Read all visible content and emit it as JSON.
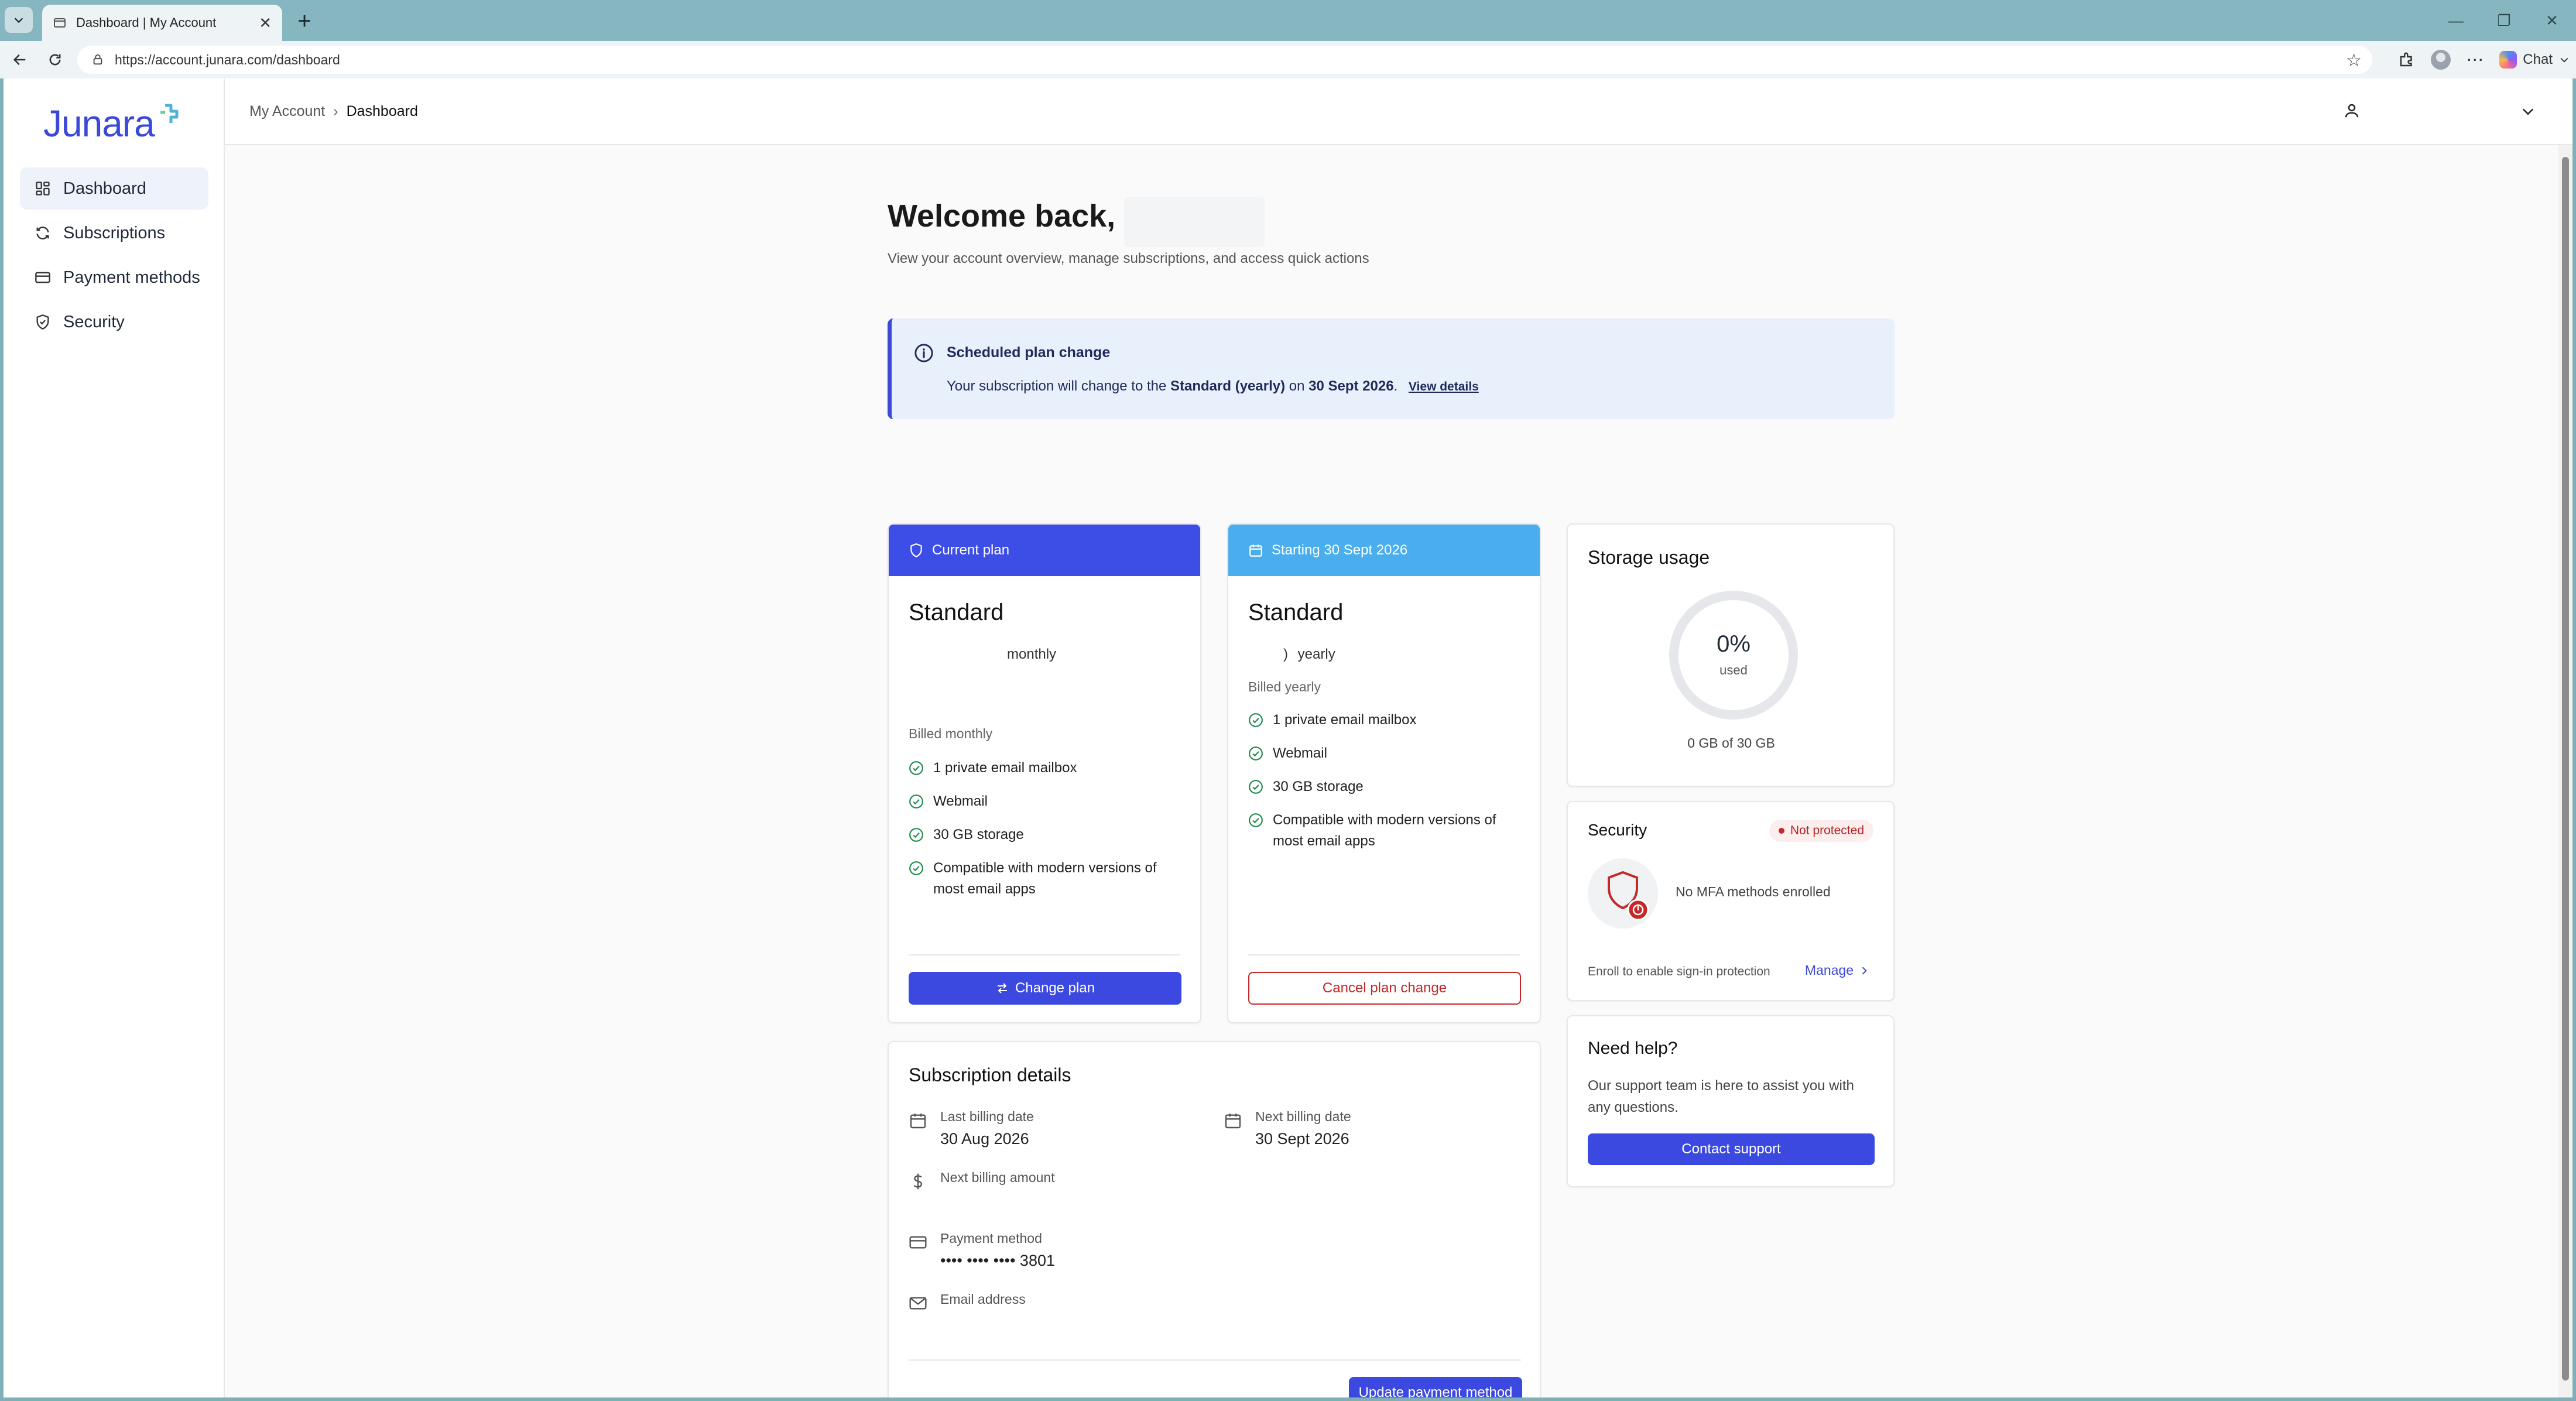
{
  "browser": {
    "tab_title": "Dashboard | My Account",
    "url": "https://account.junara.com/dashboard",
    "chat_label": "Chat"
  },
  "sidebar": {
    "logo_text": "Junara",
    "items": [
      {
        "label": "Dashboard",
        "icon": "dashboard-grid-icon"
      },
      {
        "label": "Subscriptions",
        "icon": "refresh-icon"
      },
      {
        "label": "Payment methods",
        "icon": "credit-card-icon"
      },
      {
        "label": "Security",
        "icon": "shield-check-icon"
      }
    ]
  },
  "header": {
    "breadcrumb": {
      "parent": "My Account",
      "current": "Dashboard"
    }
  },
  "main": {
    "welcome": "Welcome back,",
    "subtitle": "View your account overview, manage subscriptions, and access quick actions"
  },
  "alert": {
    "title": "Scheduled plan change",
    "body_prefix": "Your subscription will change to the",
    "plan": "Standard (yearly)",
    "on": "on",
    "date": "30 Sept 2026",
    "period": ".",
    "link": "View details"
  },
  "current_plan": {
    "header": "Current plan",
    "name": "Standard",
    "cycle": "monthly",
    "billed": "Billed monthly",
    "features": [
      "1 private email mailbox",
      "Webmail",
      "30 GB storage",
      "Compatible with modern versions of most email apps"
    ],
    "button": "Change plan"
  },
  "next_plan": {
    "header": "Starting 30 Sept 2026",
    "name": "Standard",
    "cycle_prefix": ")",
    "cycle": "yearly",
    "billed": "Billed yearly",
    "features": [
      "1 private email mailbox",
      "Webmail",
      "30 GB storage",
      "Compatible with modern versions of most email apps"
    ],
    "button": "Cancel plan change"
  },
  "storage": {
    "title": "Storage usage",
    "percent": "0%",
    "used_label": "used",
    "percent_used": 0,
    "amount": "0 GB of 30 GB"
  },
  "security": {
    "title": "Security",
    "badge": "Not protected",
    "mfa": "No MFA methods enrolled",
    "enroll": "Enroll to enable sign-in protection",
    "manage": "Manage"
  },
  "help": {
    "title": "Need help?",
    "text": "Our support team is here to assist you with any questions.",
    "button": "Contact support"
  },
  "subscription_details": {
    "title": "Subscription details",
    "last_billing_label": "Last billing date",
    "last_billing_value": "30 Aug 2026",
    "next_billing_label": "Next billing date",
    "next_billing_value": "30 Sept 2026",
    "next_amount_label": "Next billing amount",
    "payment_method_label": "Payment method",
    "payment_method_value": "•••• •••• •••• 3801",
    "email_label": "Email address",
    "button": "Update payment method"
  },
  "colors": {
    "accent": "#3b49e0",
    "current_plan_header": "#3d4ee6",
    "next_plan_header": "#4aaeee",
    "success": "#1f8a4c",
    "danger": "#c62828"
  }
}
